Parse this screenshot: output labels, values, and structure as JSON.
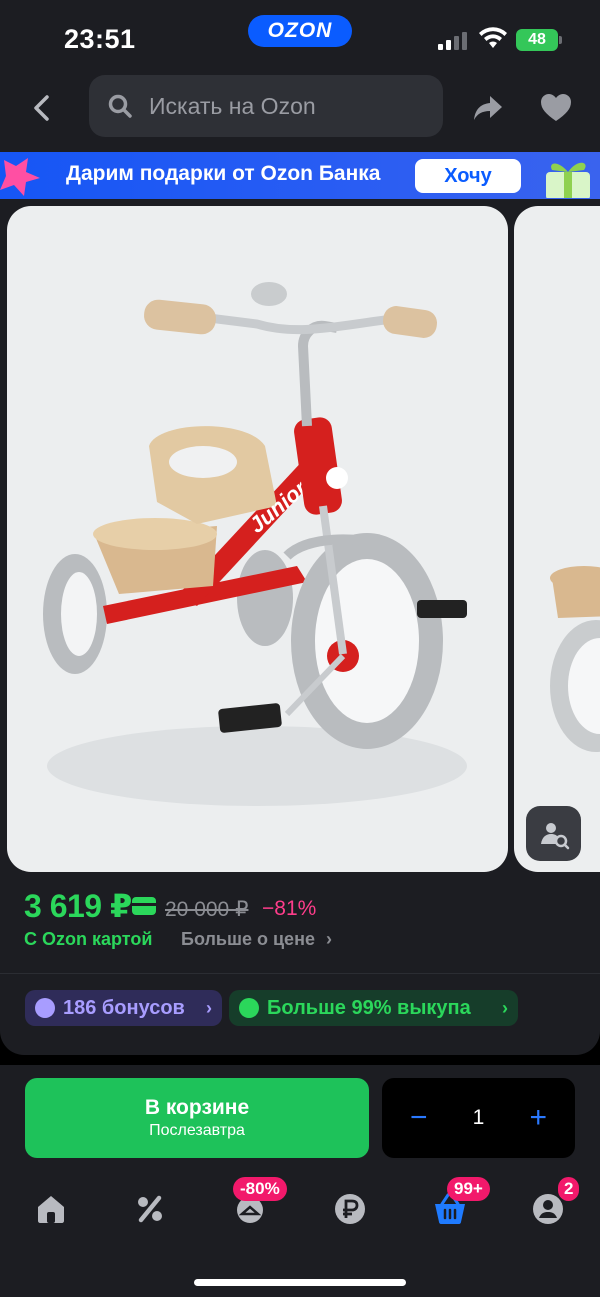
{
  "status_bar": {
    "time": "23:51",
    "brand": "OZON",
    "battery": "48"
  },
  "header": {
    "search_placeholder": "Искать на Ozon"
  },
  "promo_banner": {
    "text": "Дарим подарки от Ozon Банка",
    "button_label": "Хочу"
  },
  "product": {
    "main_image_label": "Junior",
    "price": "3 619 ₽",
    "old_price": "20 000 ₽",
    "discount": "−81%",
    "price_note": "С Ozon картой",
    "more_price_link": "Больше о цене",
    "badges": [
      {
        "label": "186 бонусов"
      },
      {
        "label": "Больше 99% выкупа"
      }
    ]
  },
  "purchase": {
    "cart_button_title": "В корзине",
    "cart_button_subtitle": "Послезавтра",
    "quantity": "1"
  },
  "tabbar": {
    "items": [
      {
        "name": "home"
      },
      {
        "name": "sales",
        "badge": ""
      },
      {
        "name": "fresh",
        "badge": "-80%"
      },
      {
        "name": "rub"
      },
      {
        "name": "cart",
        "badge": "99+"
      },
      {
        "name": "profile",
        "badge": "2"
      }
    ]
  },
  "colors": {
    "accent_green": "#2bd75b",
    "brand_blue": "#0a5cff",
    "discount_pink": "#ff3d8b",
    "badge_pink": "#f2196b"
  }
}
